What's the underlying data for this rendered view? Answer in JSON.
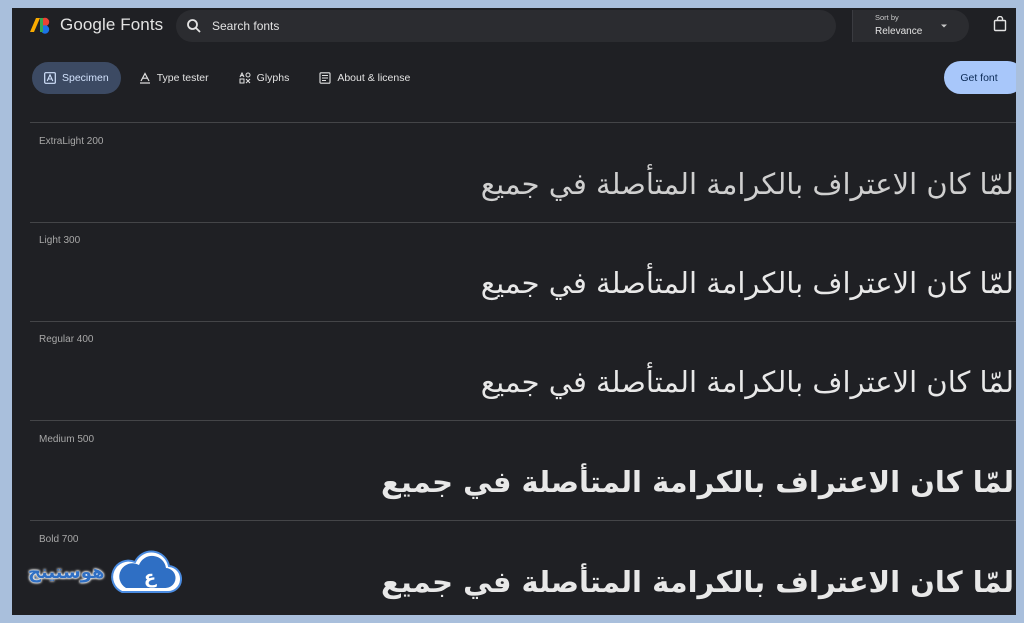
{
  "brand": {
    "name": "Google Fonts"
  },
  "search": {
    "placeholder": "Search fonts"
  },
  "sort": {
    "label": "Sort by",
    "value": "Relevance"
  },
  "tabs": [
    {
      "label": "Specimen",
      "icon": "specimen-icon",
      "active": true
    },
    {
      "label": "Type tester",
      "icon": "type-tester-icon",
      "active": false
    },
    {
      "label": "Glyphs",
      "icon": "glyphs-icon",
      "active": false
    },
    {
      "label": "About & license",
      "icon": "about-icon",
      "active": false
    }
  ],
  "actions": {
    "get_font": "Get font"
  },
  "specimens": [
    {
      "label": "ExtraLight 200",
      "sample": "لمّا كان الاعتراف بالكرامة المتأصلة في جميع"
    },
    {
      "label": "Light 300",
      "sample": "لمّا كان الاعتراف بالكرامة المتأصلة في جميع"
    },
    {
      "label": "Regular 400",
      "sample": "لمّا كان الاعتراف بالكرامة المتأصلة في جميع"
    },
    {
      "label": "Medium 500",
      "sample": "لمّا كان الاعتراف بالكرامة المتأصلة في جميع"
    },
    {
      "label": "Bold 700",
      "sample": "لمّا كان الاعتراف بالكرامة المتأصلة في جميع"
    }
  ],
  "watermark": {
    "text": "هوستينج",
    "letter": "ع"
  },
  "colors": {
    "background": "#1f2024",
    "accent": "#a8c7fa",
    "active_tab": "#3c4a63"
  }
}
